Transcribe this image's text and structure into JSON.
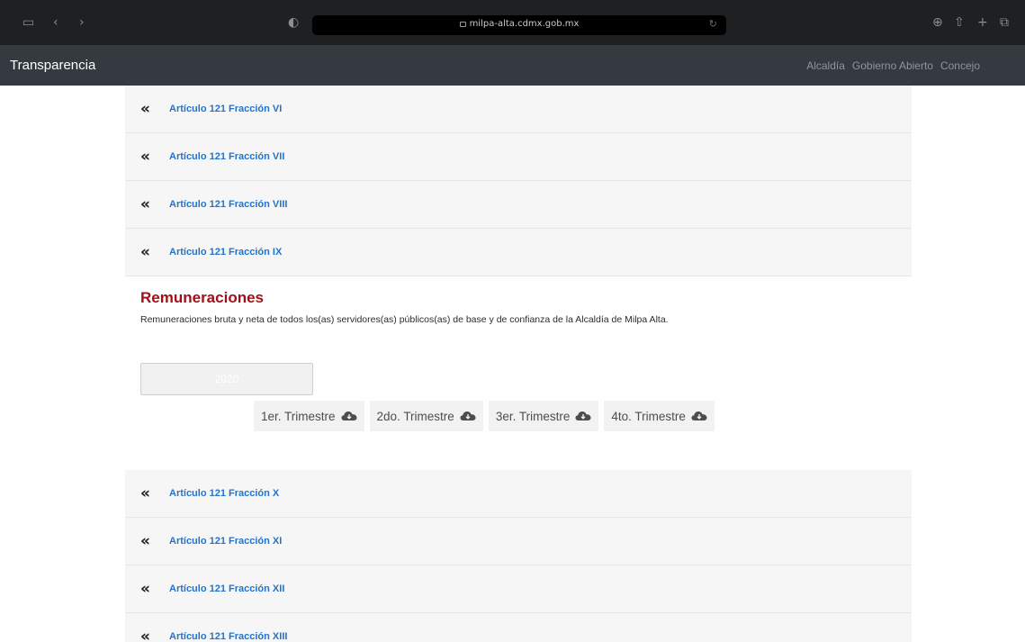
{
  "browser": {
    "url": "milpa-alta.cdmx.gob.mx"
  },
  "nav": {
    "brand": "Transparencia",
    "links": [
      "Alcaldía",
      "Gobierno Abierto",
      "Concejo"
    ]
  },
  "accordion_top": [
    "Artículo 121 Fracción VI",
    "Artículo 121 Fracción VII",
    "Artículo 121 Fracción VIII",
    "Artículo 121 Fracción IX"
  ],
  "panel": {
    "title": "Remuneraciones",
    "description": "Remuneraciones bruta y neta de todos los(as) servidores(as) públicos(as) de base y de confianza de la Alcaldía de Milpa Alta.",
    "year": "2020",
    "quarters": [
      "1er. Trimestre",
      "2do. Trimestre",
      "3er. Trimestre",
      "4to. Trimestre"
    ]
  },
  "accordion_bottom": [
    "Artículo 121 Fracción X",
    "Artículo 121 Fracción XI",
    "Artículo 121 Fracción XII",
    "Artículo 121 Fracción XIII"
  ],
  "colors": {
    "link": "#2374c9",
    "panel_title": "#a10f19",
    "navbar": "#343a40"
  }
}
